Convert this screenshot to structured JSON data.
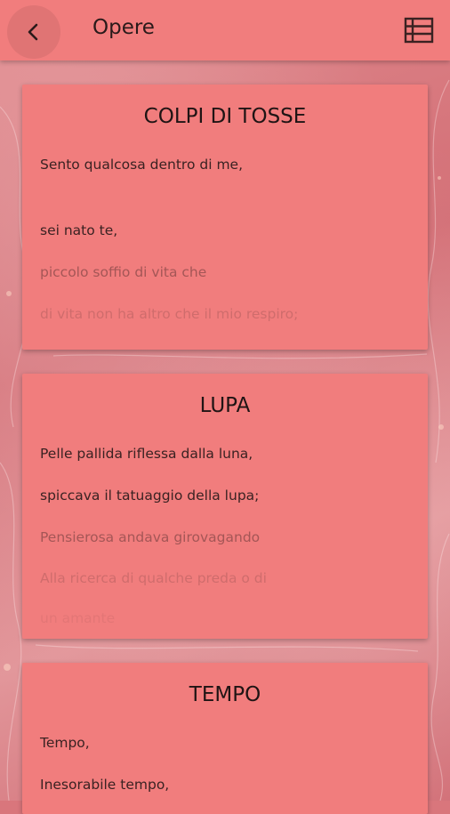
{
  "header": {
    "title": "Opere",
    "back_icon": "chevron-left-icon",
    "menu_icon": "list-view-icon"
  },
  "colors": {
    "app_bar": "#f17d7d",
    "card": "#f17d7d",
    "background": "#d9767c"
  },
  "poems": [
    {
      "title": "COLPI DI TOSSE",
      "lines": [
        "Sento qualcosa dentro di me,",
        "",
        "sei nato te,",
        "piccolo soffio di vita che",
        "di vita non ha altro che il mio respiro;"
      ]
    },
    {
      "title": "LUPA",
      "lines": [
        "Pelle pallida riflessa dalla luna,",
        "spiccava il tatuaggio della lupa;",
        "Pensierosa andava girovagando",
        "Alla ricerca di qualche preda o di",
        "un amante"
      ]
    },
    {
      "title": "TEMPO",
      "lines": [
        "Tempo,",
        "Inesorabile tempo,"
      ]
    }
  ]
}
